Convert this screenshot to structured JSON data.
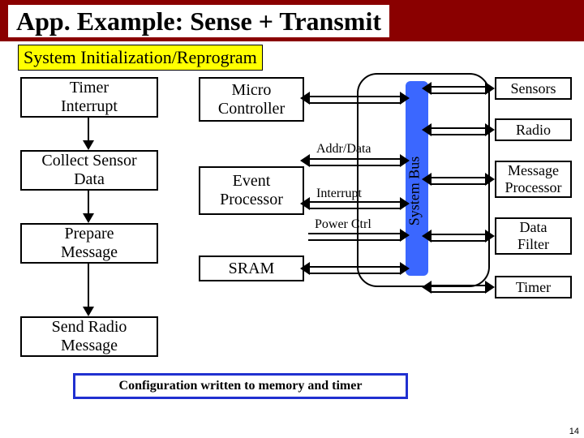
{
  "title": "App. Example: Sense + Transmit",
  "subtitle": "System Initialization/Reprogram",
  "flow": {
    "timer_interrupt": "Timer\nInterrupt",
    "collect_sensor": "Collect Sensor\nData",
    "prepare_message": "Prepare\nMessage",
    "send_radio": "Send Radio\nMessage"
  },
  "hw": {
    "micro_controller": "Micro\nController",
    "event_processor": "Event\nProcessor",
    "sram": "SRAM",
    "sensors": "Sensors",
    "radio": "Radio",
    "msg_processor": "Message\nProcessor",
    "data_filter": "Data\nFilter",
    "timer": "Timer",
    "system_bus": "System Bus"
  },
  "signals": {
    "addr_data": "Addr/Data",
    "interrupt": "Interrupt",
    "power_ctrl": "Power Ctrl"
  },
  "footer": "Configuration written to memory and timer",
  "page_number": "14"
}
